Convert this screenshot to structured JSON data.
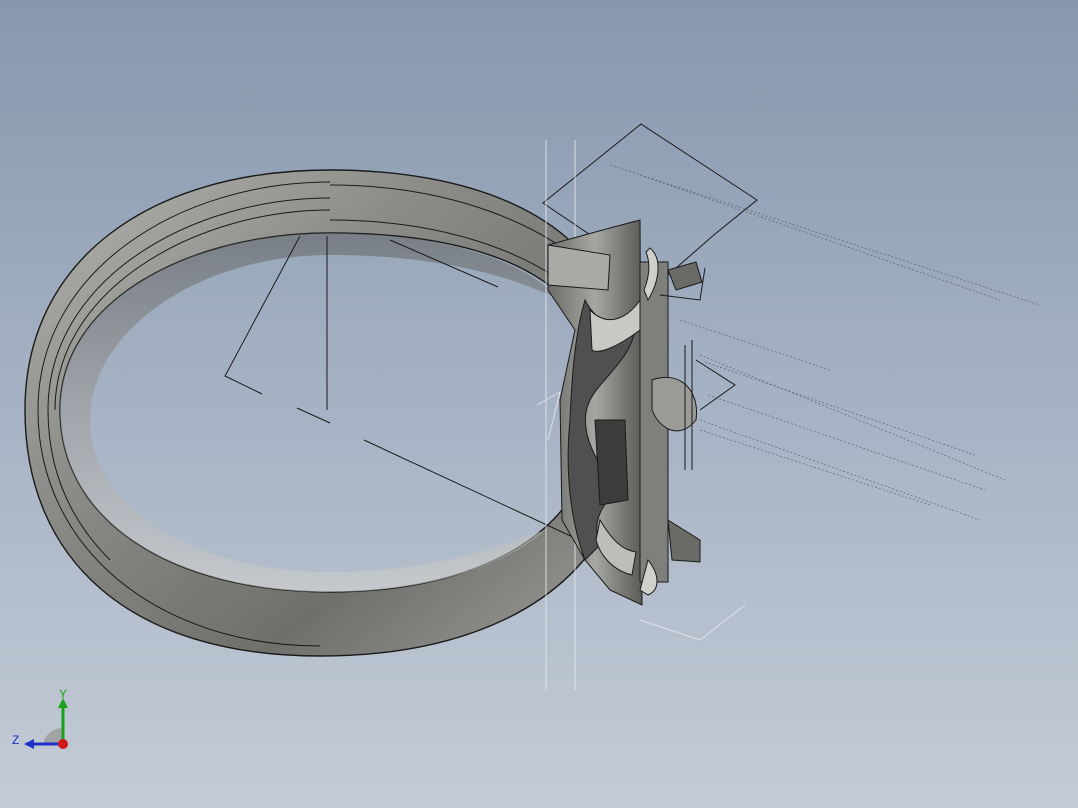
{
  "viewport": {
    "background_top": "#8797ae",
    "background_bottom": "#c4cbd6"
  },
  "model": {
    "kind": "ring",
    "metal_color": "#8a8a88",
    "edge_color": "#1a1a1a"
  },
  "triad": {
    "y_label": "Y",
    "z_label": "Z",
    "y_color": "#1aa31a",
    "z_color": "#1f2fc8",
    "x_color": "#d01818"
  }
}
